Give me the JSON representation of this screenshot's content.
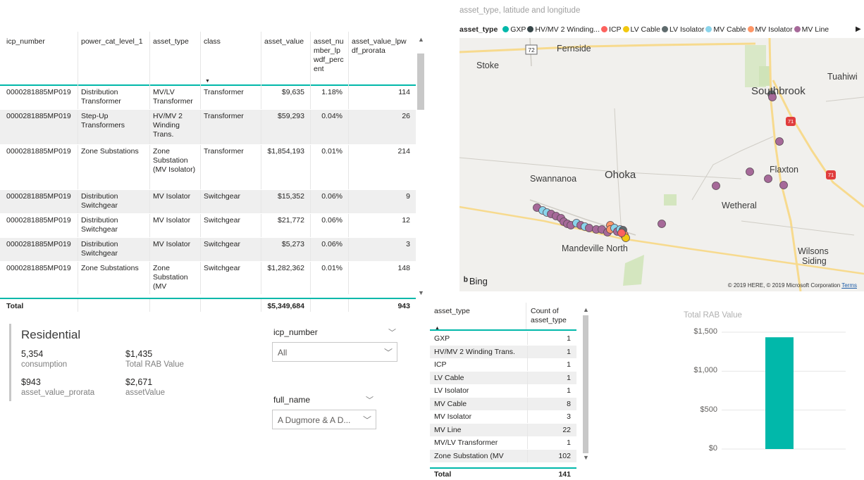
{
  "main_table": {
    "columns": [
      "icp_number",
      "power_cat_level_1",
      "asset_type",
      "class",
      "asset_value",
      "asset_nu mber_lp wdf_perc ent",
      "asset_value_lpw df_prorata"
    ],
    "rows": [
      [
        "0000281885MP019",
        "Distribution Transformer",
        "MV/LV Transformer",
        "Transformer",
        "$9,635",
        "1.18%",
        "114"
      ],
      [
        "0000281885MP019",
        "Step-Up Transformers",
        "HV/MV 2 Winding Trans.",
        "Transformer",
        "$59,293",
        "0.04%",
        "26"
      ],
      [
        "0000281885MP019",
        "Zone Substations",
        "Zone Substation (MV Isolator)",
        "Transformer",
        "$1,854,193",
        "0.01%",
        "214"
      ],
      [
        "0000281885MP019",
        "Distribution Switchgear",
        "MV Isolator",
        "Switchgear",
        "$15,352",
        "0.06%",
        "9"
      ],
      [
        "0000281885MP019",
        "Distribution Switchgear",
        "MV Isolator",
        "Switchgear",
        "$21,772",
        "0.06%",
        "12"
      ],
      [
        "0000281885MP019",
        "Distribution Switchgear",
        "MV Isolator",
        "Switchgear",
        "$5,273",
        "0.06%",
        "3"
      ],
      [
        "0000281885MP019",
        "Zone Substations",
        "Zone Substation (MV",
        "Switchgear",
        "$1,282,362",
        "0.01%",
        "148"
      ]
    ],
    "total": {
      "label": "Total",
      "asset_value": "$5,349,684",
      "prorata": "943"
    }
  },
  "card": {
    "title": "Residential",
    "kpis": [
      {
        "value": "5,354",
        "label": "consumption"
      },
      {
        "value": "$1,435",
        "label": "Total RAB Value"
      },
      {
        "value": "$943",
        "label": "asset_value_prorata"
      },
      {
        "value": "$2,671",
        "label": "assetValue"
      }
    ]
  },
  "slicers": {
    "icp": {
      "title": "icp_number",
      "value": "All"
    },
    "name": {
      "title": "full_name",
      "value": "A Dugmore & A D..."
    }
  },
  "map": {
    "title": "asset_type, latitude and longitude",
    "legend_title": "asset_type",
    "legend": [
      {
        "label": "GXP",
        "color": "#01b8aa"
      },
      {
        "label": "HV/MV 2 Winding...",
        "color": "#374649"
      },
      {
        "label": "ICP",
        "color": "#fd625e"
      },
      {
        "label": "LV Cable",
        "color": "#f2c80f"
      },
      {
        "label": "LV Isolator",
        "color": "#5f6b6d"
      },
      {
        "label": "MV Cable",
        "color": "#8ad4eb"
      },
      {
        "label": "MV Isolator",
        "color": "#fe9666"
      },
      {
        "label": "MV Line",
        "color": "#a66999"
      }
    ],
    "places": [
      "Fernside",
      "Stoke",
      "Tuahiwi",
      "Southbrook",
      "Swannanoa",
      "Ohoka",
      "Flaxton",
      "Wetheral",
      "Mandeville North",
      "Wilsons",
      "Siding"
    ],
    "road_shields": [
      "72",
      "71",
      "71"
    ],
    "bing": "Bing",
    "copyright": "© 2019 HERE, © 2019 Microsoft Corporation",
    "terms": "Terms"
  },
  "count_table": {
    "columns": [
      "asset_type",
      "Count of asset_type"
    ],
    "rows": [
      [
        "GXP",
        "1"
      ],
      [
        "HV/MV 2 Winding Trans.",
        "1"
      ],
      [
        "ICP",
        "1"
      ],
      [
        "LV Cable",
        "1"
      ],
      [
        "LV Isolator",
        "1"
      ],
      [
        "MV Cable",
        "8"
      ],
      [
        "MV Isolator",
        "3"
      ],
      [
        "MV Line",
        "22"
      ],
      [
        "MV/LV Transformer",
        "1"
      ],
      [
        "Zone Substation (MV",
        "102"
      ]
    ],
    "total": {
      "label": "Total",
      "value": "141"
    }
  },
  "chart_data": {
    "type": "bar",
    "title": "Total RAB Value",
    "categories": [
      ""
    ],
    "values": [
      1435
    ],
    "ylim": [
      0,
      1500
    ],
    "yticks": [
      "$0",
      "$500",
      "$1,000",
      "$1,500"
    ],
    "color": "#01b8aa",
    "grid": true
  }
}
